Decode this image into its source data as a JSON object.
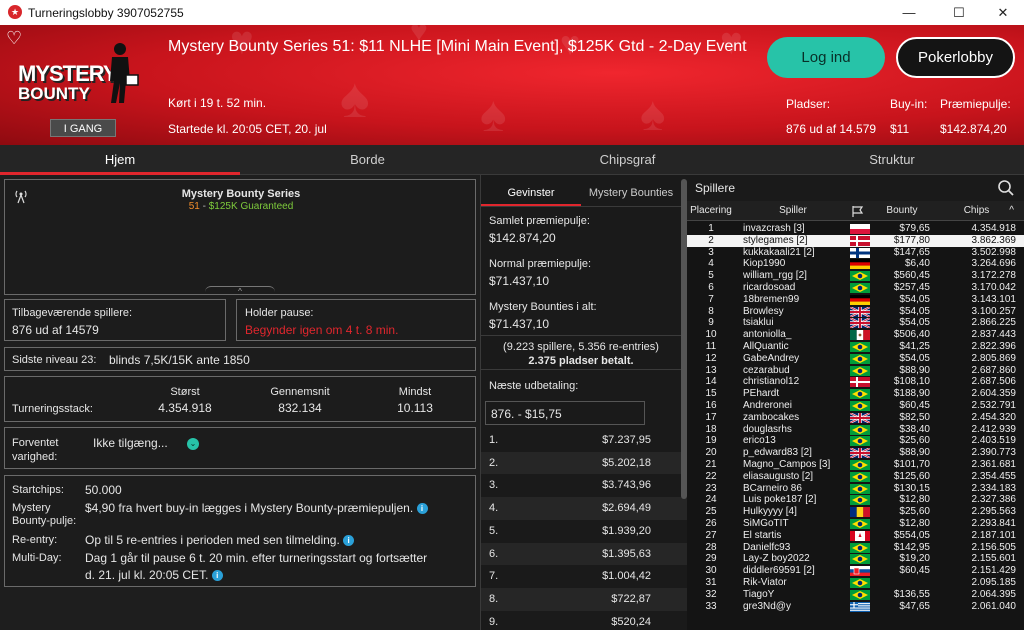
{
  "window": {
    "title": "Turneringslobby 3907052755",
    "min": "—",
    "max": "☐",
    "close": "✕"
  },
  "header": {
    "logo_line1": "MYSTERY",
    "logo_line2": "BOUNTY",
    "status": "I GANG",
    "title": "Mystery Bounty Series 51: $11 NLHE [Mini Main Event], $125K Gtd - 2-Day Event",
    "running": "Kørt i 19 t. 52 min.",
    "started": "Startede kl. 20:05 CET, 20. jul",
    "login": "Log ind",
    "lobby": "Pokerlobby",
    "players_label": "Pladser:",
    "players_value": "876 ud af 14.579",
    "buyin_label": "Buy-in:",
    "buyin_value": "$11",
    "pool_label": "Præmiepulje:",
    "pool_value": "$142.874,20"
  },
  "nav": {
    "tabs": [
      "Hjem",
      "Borde",
      "Chipsgraf",
      "Struktur"
    ],
    "active": 0
  },
  "left": {
    "series_title": "Mystery Bounty Series",
    "series_num": "51",
    "series_sep": " - ",
    "series_gtd": "$125K Guaranteed",
    "remaining_label": "Tilbageværende spillere:",
    "remaining_value": "876 ud af 14579",
    "pause_label": "Holder pause:",
    "pause_value": "Begynder igen om 4 t. 8 min.",
    "level_label": "Sidste niveau 23:",
    "level_value": "blinds 7,5K/15K ante 1850",
    "stack_label": "Turneringsstack:",
    "largest_label": "Størst",
    "largest_value": "4.354.918",
    "avg_label": "Gennemsnit",
    "avg_value": "832.134",
    "min_label": "Mindst",
    "min_value": "10.113",
    "duration_label1": "Forventet",
    "duration_label2": "varighed:",
    "duration_value": "Ikke tilgæng...",
    "startchips_label": "Startchips:",
    "startchips_value": "50.000",
    "mb_label1": "Mystery",
    "mb_label2": "Bounty-pulje:",
    "mb_value": "$4,90 fra hvert buy-in lægges i Mystery Bounty-præmiepuljen.",
    "reentry_label": "Re-entry:",
    "reentry_value": "Op til 5 re-entries i perioden med sen tilmelding.",
    "multiday_label": "Multi-Day:",
    "multiday_value1": "Dag 1 går til pause 6 t. 20 min. efter turneringsstart og fortsætter",
    "multiday_value2": "d. 21. jul kl. 20:05 CET."
  },
  "prizes": {
    "tab_winners": "Gevinster",
    "tab_bounties": "Mystery Bounties",
    "total_label": "Samlet præmiepulje:",
    "total_value": "$142.874,20",
    "normal_label": "Normal præmiepulje:",
    "normal_value": "$71.437,10",
    "mb_label": "Mystery Bounties i alt:",
    "mb_value": "$71.437,10",
    "entries": "(9.223 spillere, 5.356 re-entries)",
    "paid": "2.375 pladser betalt.",
    "next_label": "Næste udbetaling:",
    "next_value": "876. - $15,75",
    "rows": [
      [
        "1.",
        "$7.237,95"
      ],
      [
        "2.",
        "$5.202,18"
      ],
      [
        "3.",
        "$3.743,96"
      ],
      [
        "4.",
        "$2.694,49"
      ],
      [
        "5.",
        "$1.939,20"
      ],
      [
        "6.",
        "$1.395,63"
      ],
      [
        "7.",
        "$1.004,42"
      ],
      [
        "8.",
        "$722,87"
      ],
      [
        "9.",
        "$520,24"
      ]
    ]
  },
  "players": {
    "title": "Spillere",
    "cols": [
      "Placering",
      "Spiller",
      "",
      "Bounty",
      "Chips"
    ],
    "selected": 1,
    "rows": [
      [
        "1",
        "invazcrash [3]",
        "pl",
        "$79,65",
        "4.354.918"
      ],
      [
        "2",
        "stylegames [2]",
        "dk",
        "$177,80",
        "3.862.369"
      ],
      [
        "3",
        "kukkakaali21 [2]",
        "fi",
        "$147,65",
        "3.502.998"
      ],
      [
        "4",
        "Kiop1990",
        "de",
        "$6,40",
        "3.264.696"
      ],
      [
        "5",
        "william_rgg [2]",
        "br",
        "$560,45",
        "3.172.278"
      ],
      [
        "6",
        "ricardosoad",
        "br",
        "$257,45",
        "3.170.042"
      ],
      [
        "7",
        "18bremen99",
        "de",
        "$54,05",
        "3.143.101"
      ],
      [
        "8",
        "Browlesy",
        "gb",
        "$54,05",
        "3.100.257"
      ],
      [
        "9",
        "tsiaklui",
        "gb",
        "$54,05",
        "2.866.225"
      ],
      [
        "10",
        "antoniolla_",
        "mx",
        "$506,40",
        "2.837.443"
      ],
      [
        "11",
        "AllQuantic",
        "br",
        "$41,25",
        "2.822.396"
      ],
      [
        "12",
        "GabeAndrey",
        "br",
        "$54,05",
        "2.805.869"
      ],
      [
        "13",
        "cezarabud",
        "br",
        "$88,90",
        "2.687.860"
      ],
      [
        "14",
        "christianol12",
        "dk",
        "$108,10",
        "2.687.506"
      ],
      [
        "15",
        "PEhardt",
        "br",
        "$188,90",
        "2.604.359"
      ],
      [
        "16",
        "Andreronei",
        "br",
        "$60,45",
        "2.532.791"
      ],
      [
        "17",
        "zambocakes",
        "gb",
        "$82,50",
        "2.454.320"
      ],
      [
        "18",
        "douglasrhs",
        "br",
        "$38,40",
        "2.412.939"
      ],
      [
        "19",
        "erico13",
        "br",
        "$25,60",
        "2.403.519"
      ],
      [
        "20",
        "p_edward83 [2]",
        "gb",
        "$88,90",
        "2.390.773"
      ],
      [
        "21",
        "Magno_Campos [3]",
        "br",
        "$101,70",
        "2.361.681"
      ],
      [
        "22",
        "eliasaugusto [2]",
        "br",
        "$125,60",
        "2.354.455"
      ],
      [
        "23",
        "BCarneiro 86",
        "br",
        "$130,15",
        "2.334.183"
      ],
      [
        "24",
        "Luis poke187 [2]",
        "br",
        "$12,80",
        "2.327.386"
      ],
      [
        "25",
        "Hulkyyyy [4]",
        "ro",
        "$25,60",
        "2.295.563"
      ],
      [
        "26",
        "SiMGoTIT",
        "br",
        "$12,80",
        "2.293.841"
      ],
      [
        "27",
        "El startis",
        "ca",
        "$554,05",
        "2.187.101"
      ],
      [
        "28",
        "Danielfc93",
        "br",
        "$142,95",
        "2.156.505"
      ],
      [
        "29",
        "Lay-Z boy2022",
        "br",
        "$19,20",
        "2.155.601"
      ],
      [
        "30",
        "diddler69591 [2]",
        "sk",
        "$60,45",
        "2.151.429"
      ],
      [
        "31",
        "Rik-Viator",
        "br",
        "",
        "2.095.185"
      ],
      [
        "32",
        "TiagoY",
        "br",
        "$136,55",
        "2.064.395"
      ],
      [
        "33",
        "gre3Nd@y",
        "gr",
        "$47,65",
        "2.061.040"
      ]
    ]
  },
  "colors": {
    "accent": "#e0262d",
    "login": "#27c3a8",
    "header_red": "#d51a22"
  }
}
